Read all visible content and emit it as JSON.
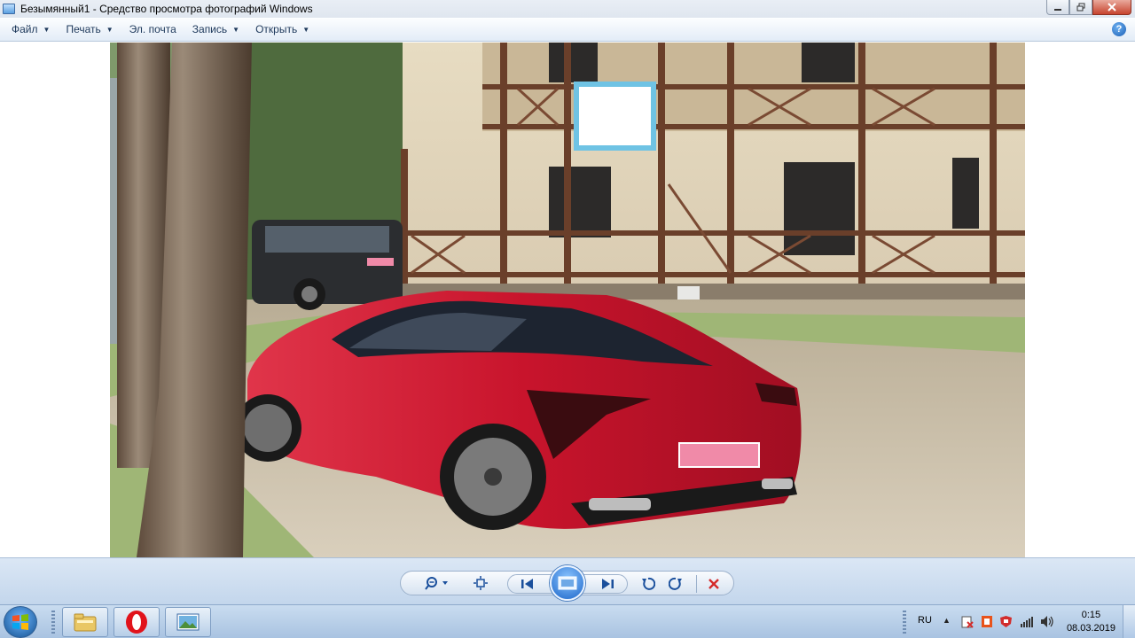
{
  "window": {
    "title": "Безымянный1 - Средство просмотра фотографий Windows"
  },
  "menu": {
    "items": [
      {
        "label": "Файл",
        "dropdown": true
      },
      {
        "label": "Печать",
        "dropdown": true
      },
      {
        "label": "Эл. почта",
        "dropdown": false
      },
      {
        "label": "Запись",
        "dropdown": true
      },
      {
        "label": "Открыть",
        "dropdown": true
      }
    ],
    "help_icon": "?"
  },
  "controls": {
    "zoom_icon": "zoom-icon",
    "fit_icon": "actual-size-icon",
    "prev_icon": "previous-icon",
    "slideshow_icon": "slideshow-icon",
    "next_icon": "next-icon",
    "rotate_ccw_icon": "rotate-counterclockwise-icon",
    "rotate_cw_icon": "rotate-clockwise-icon",
    "delete_icon": "delete-icon"
  },
  "taskbar": {
    "apps": [
      "file-explorer-icon",
      "opera-icon",
      "photo-viewer-icon"
    ],
    "language": "RU",
    "time": "0:15",
    "date": "08.03.2019"
  },
  "colors": {
    "car_red": "#c8142c",
    "accent_blue": "#1c66c9"
  }
}
